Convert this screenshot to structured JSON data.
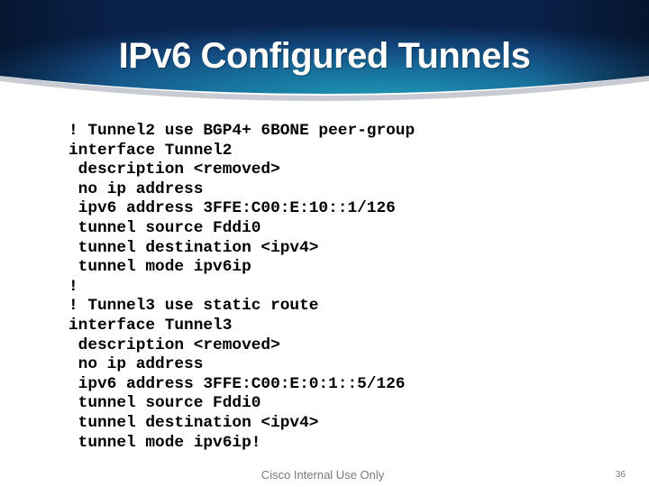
{
  "slide": {
    "title": "IPv6 Configured Tunnels",
    "code_lines": [
      "! Tunnel2 use BGP4+ 6BONE peer-group",
      "interface Tunnel2",
      " description <removed>",
      " no ip address",
      " ipv6 address 3FFE:C00:E:10::1/126",
      " tunnel source Fddi0",
      " tunnel destination <ipv4>",
      " tunnel mode ipv6ip",
      "!",
      "! Tunnel3 use static route",
      "interface Tunnel3",
      " description <removed>",
      " no ip address",
      " ipv6 address 3FFE:C00:E:0:1::5/126",
      " tunnel source Fddi0",
      " tunnel destination <ipv4>",
      " tunnel mode ipv6ip!"
    ],
    "footer": "Cisco Internal Use Only",
    "page_number": "36"
  },
  "colors": {
    "banner_dark": "#0b2a52",
    "banner_mid": "#14508a",
    "banner_light": "#1a8fb0",
    "title_text": "#ffffff",
    "footer_text": "#7a7a7a"
  }
}
